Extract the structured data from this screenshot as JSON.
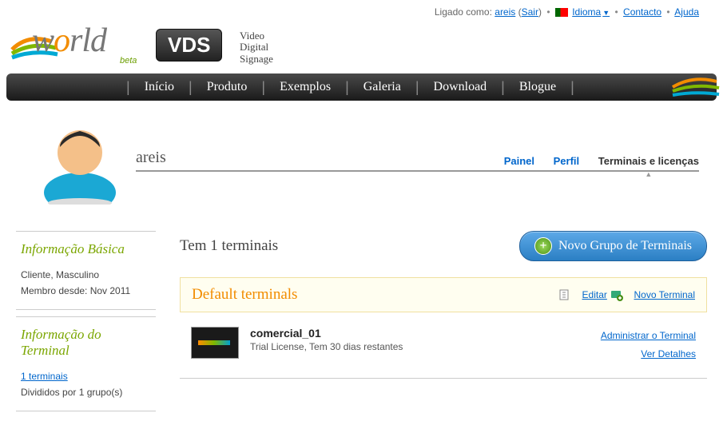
{
  "top": {
    "logged_as_label": "Ligado como:",
    "user": "areis",
    "logout": "Sair",
    "language": "Idioma",
    "contact": "Contacto",
    "help": "Ajuda"
  },
  "logo": {
    "world": "world",
    "beta": "beta",
    "vds": "VDS",
    "tag1": "Video",
    "tag2": "Digital",
    "tag3": "Signage"
  },
  "nav": {
    "inicio": "Início",
    "produto": "Produto",
    "exemplos": "Exemplos",
    "galeria": "Galeria",
    "download": "Download",
    "blogue": "Blogue"
  },
  "profile": {
    "name": "areis",
    "tab_painel": "Painel",
    "tab_perfil": "Perfil",
    "tab_terminais": "Terminais e licenças"
  },
  "sidebar": {
    "basic_title": "Informação Básica",
    "basic_line1": "Cliente, Masculino",
    "basic_line2": "Membro desde: Nov 2011",
    "term_title": "Informação do Terminal",
    "term_link": "1 terminais",
    "term_line2": "Divididos por 1 grupo(s)"
  },
  "content": {
    "heading": "Tem 1 terminais",
    "new_group_btn": "Novo Grupo de Terminais",
    "group_name": "Default terminals",
    "edit": "Editar",
    "new_terminal": "Novo Terminal",
    "terminal_name": "comercial_01",
    "terminal_status": "Trial License, Tem 30 dias restantes",
    "manage": "Administrar o Terminal",
    "details": "Ver Detalhes"
  }
}
